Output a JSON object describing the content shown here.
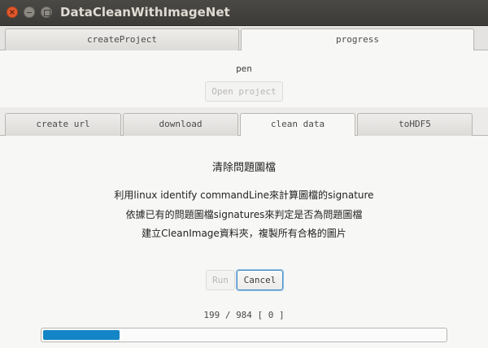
{
  "window": {
    "title": "DataCleanWithImageNet"
  },
  "outer_tabs": [
    "createProject",
    "progress"
  ],
  "project": {
    "file_label": "pen",
    "open_button": "Open project"
  },
  "inner_tabs": [
    "create url",
    "download",
    "clean data",
    "toHDF5"
  ],
  "clean": {
    "heading": "清除問題圖檔",
    "lines": [
      "利用linux identify commandLine來計算圖檔的signature",
      "依據已有的問題圖檔signatures來判定是否為問題圖檔",
      "建立CleanImage資料夾，複製所有合格的圖片"
    ],
    "run_button": "Run",
    "cancel_button": "Cancel",
    "counter": "199 / 984 [ 0 ]",
    "progress": 0.1911
  },
  "colors": {
    "progress_fill": "#1485c6",
    "title_bar": "#3c3b37",
    "close_button": "#e2582c"
  }
}
